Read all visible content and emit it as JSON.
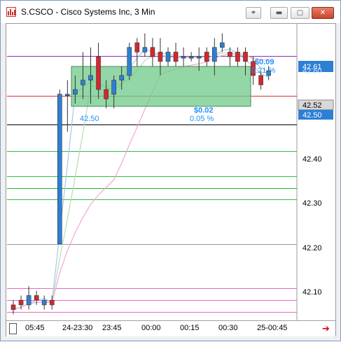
{
  "window": {
    "title": "S.CSCO - Cisco Systems Inc, 3 Min",
    "buttons": {
      "link": "⚭",
      "minimize": "▬",
      "maximize": "▢",
      "close": "✕"
    }
  },
  "price_axis": {
    "ticks": [
      "42.60",
      "42.40",
      "42.30",
      "42.20",
      "42.10"
    ],
    "markers": {
      "high": "42.61",
      "close": "42.52",
      "current": "42.50"
    }
  },
  "time_axis": {
    "labels": [
      "05:45",
      "24-23:30",
      "23:45",
      "00:00",
      "00:15",
      "00:30",
      "25-00:45"
    ]
  },
  "annotations": {
    "left_price": "42.50",
    "measure_change": "$0.02",
    "measure_pct": "0.05 %",
    "right_change": "$0.09",
    "right_pct": "0.21 %"
  },
  "colors": {
    "bull": "#2d7fd4",
    "bear": "#d6262d",
    "zone": "#6fc98a",
    "annotation": "#1e90ff"
  },
  "chart_data": {
    "type": "candlestick",
    "ylim": [
      42.04,
      42.66
    ],
    "candles": [
      {
        "o": 42.07,
        "h": 42.08,
        "l": 42.05,
        "c": 42.06
      },
      {
        "o": 42.08,
        "h": 42.09,
        "l": 42.06,
        "c": 42.07
      },
      {
        "o": 42.07,
        "h": 42.11,
        "l": 42.06,
        "c": 42.09
      },
      {
        "o": 42.09,
        "h": 42.1,
        "l": 42.07,
        "c": 42.08
      },
      {
        "o": 42.07,
        "h": 42.09,
        "l": 42.06,
        "c": 42.08
      },
      {
        "o": 42.08,
        "h": 42.09,
        "l": 42.06,
        "c": 42.07
      },
      {
        "o": 42.2,
        "h": 42.53,
        "l": 42.2,
        "c": 42.52
      },
      {
        "o": 42.52,
        "h": 42.55,
        "l": 42.44,
        "c": 42.52
      },
      {
        "o": 42.52,
        "h": 42.56,
        "l": 42.5,
        "c": 42.53
      },
      {
        "o": 42.54,
        "h": 42.61,
        "l": 42.51,
        "c": 42.55
      },
      {
        "o": 42.55,
        "h": 42.62,
        "l": 42.5,
        "c": 42.56
      },
      {
        "o": 42.6,
        "h": 42.63,
        "l": 42.51,
        "c": 42.53
      },
      {
        "o": 42.53,
        "h": 42.55,
        "l": 42.49,
        "c": 42.51
      },
      {
        "o": 42.52,
        "h": 42.56,
        "l": 42.49,
        "c": 42.55
      },
      {
        "o": 42.55,
        "h": 42.58,
        "l": 42.53,
        "c": 42.56
      },
      {
        "o": 42.56,
        "h": 42.63,
        "l": 42.55,
        "c": 42.62
      },
      {
        "o": 42.63,
        "h": 42.64,
        "l": 42.58,
        "c": 42.61
      },
      {
        "o": 42.61,
        "h": 42.65,
        "l": 42.6,
        "c": 42.62
      },
      {
        "o": 42.62,
        "h": 42.64,
        "l": 42.58,
        "c": 42.6
      },
      {
        "o": 42.61,
        "h": 42.64,
        "l": 42.56,
        "c": 42.59
      },
      {
        "o": 42.59,
        "h": 42.62,
        "l": 42.58,
        "c": 42.61
      },
      {
        "o": 42.61,
        "h": 42.63,
        "l": 42.58,
        "c": 42.59
      },
      {
        "o": 42.6,
        "h": 42.62,
        "l": 42.58,
        "c": 42.6
      },
      {
        "o": 42.6,
        "h": 42.61,
        "l": 42.59,
        "c": 42.6
      },
      {
        "o": 42.6,
        "h": 42.62,
        "l": 42.57,
        "c": 42.6
      },
      {
        "o": 42.61,
        "h": 42.62,
        "l": 42.58,
        "c": 42.59
      },
      {
        "o": 42.59,
        "h": 42.64,
        "l": 42.56,
        "c": 42.62
      },
      {
        "o": 42.62,
        "h": 42.65,
        "l": 42.61,
        "c": 42.63
      },
      {
        "o": 42.61,
        "h": 42.62,
        "l": 42.58,
        "c": 42.6
      },
      {
        "o": 42.61,
        "h": 42.62,
        "l": 42.58,
        "c": 42.59
      },
      {
        "o": 42.61,
        "h": 42.62,
        "l": 42.56,
        "c": 42.59
      },
      {
        "o": 42.59,
        "h": 42.6,
        "l": 42.54,
        "c": 42.56
      },
      {
        "o": 42.56,
        "h": 42.57,
        "l": 42.53,
        "c": 42.54
      },
      {
        "o": 42.56,
        "h": 42.58,
        "l": 42.55,
        "c": 42.57
      }
    ],
    "horizontal_levels": [
      {
        "price": 42.602,
        "color": "#8b2fb0"
      },
      {
        "price": 42.517,
        "color": "#e0303a"
      },
      {
        "price": 42.455,
        "color": "#000000"
      },
      {
        "price": 42.398,
        "color": "#36b84a"
      },
      {
        "price": 42.345,
        "color": "#36b84a"
      },
      {
        "price": 42.32,
        "color": "#10c020"
      },
      {
        "price": 42.295,
        "color": "#36b84a"
      },
      {
        "price": 42.2,
        "color": "#9a9a9a"
      },
      {
        "price": 42.105,
        "color": "#e46ac0"
      },
      {
        "price": 42.08,
        "color": "#e46ac0"
      },
      {
        "price": 42.055,
        "color": "#e46ac0"
      }
    ]
  }
}
